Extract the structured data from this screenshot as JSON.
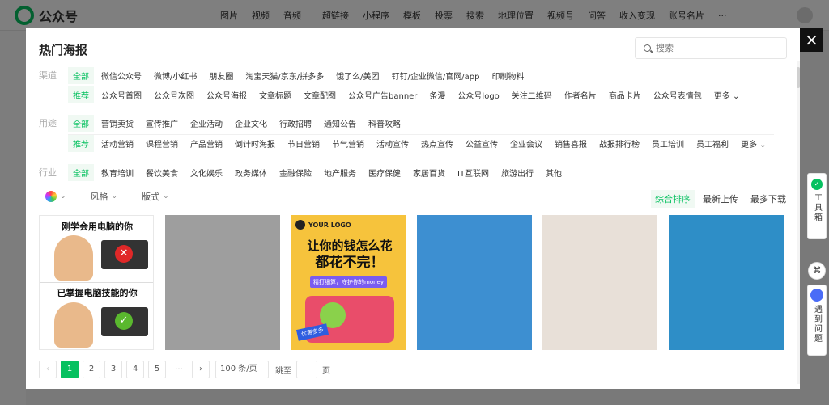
{
  "app": {
    "name": "公众号"
  },
  "topnav": [
    "图片",
    "视频",
    "音频",
    "超链接",
    "小程序",
    "模板",
    "投票",
    "搜索",
    "地理位置",
    "视频号",
    "问答",
    "收入变现",
    "账号名片",
    "···"
  ],
  "modal": {
    "title": "热门海报",
    "search_placeholder": "搜索",
    "close": "×"
  },
  "filters": {
    "channel_label": "渠道",
    "channel": [
      "全部",
      "微信公众号",
      "微博/小红书",
      "朋友圈",
      "淘宝天猫/京东/拼多多",
      "饿了么/美团",
      "钉钉/企业微信/官网/app",
      "印刷物料"
    ],
    "channel_sub": [
      "推荐",
      "公众号首图",
      "公众号次图",
      "公众号海报",
      "文章标题",
      "文章配图",
      "公众号广告banner",
      "条漫",
      "公众号logo",
      "关注二维码",
      "作者名片",
      "商品卡片",
      "公众号表情包",
      "更多 ⌄"
    ],
    "usage_label": "用途",
    "usage": [
      "全部",
      "营销卖货",
      "宣传推广",
      "企业活动",
      "企业文化",
      "行政招聘",
      "通知公告",
      "科普攻略"
    ],
    "usage_sub": [
      "推荐",
      "活动营销",
      "课程营销",
      "产品营销",
      "倒计时海报",
      "节日营销",
      "节气营销",
      "活动宣传",
      "热点宣传",
      "公益宣传",
      "企业会议",
      "销售喜报",
      "战报排行榜",
      "员工培训",
      "员工福利",
      "更多 ⌄"
    ],
    "industry_label": "行业",
    "industry": [
      "全部",
      "教育培训",
      "餐饮美食",
      "文化娱乐",
      "政务媒体",
      "金融保险",
      "地产服务",
      "医疗保健",
      "家居百货",
      "IT互联网",
      "旅游出行",
      "其他"
    ]
  },
  "toolbar": {
    "style": "风格",
    "layout": "版式"
  },
  "sort": [
    "综合排序",
    "最新上传",
    "最多下载"
  ],
  "cards": {
    "card1": {
      "top_text": "刚学会用电脑的你",
      "bottom_text": "已掌握电脑技能的你"
    },
    "card3": {
      "logo": "YOUR LOGO",
      "headline1": "让你的钱怎么花",
      "headline2": "都花不完！",
      "tag": "精打细算，守护你的money",
      "badge": "优惠多多"
    },
    "colors": [
      "#ffffff",
      "#9e9e9e",
      "#f6c33c",
      "#3d8fd1",
      "#e8e0d8",
      "#2e8ec7"
    ]
  },
  "pager": {
    "pages": [
      "1",
      "2",
      "3",
      "4",
      "5"
    ],
    "ellipsis": "···",
    "prev": "‹",
    "next": "›",
    "page_size": "100 条/页",
    "jump_label": "跳至",
    "page_unit": "页"
  },
  "side": {
    "toolbox": "工具箱",
    "help": "遇到问题"
  },
  "accent": "#07c160"
}
